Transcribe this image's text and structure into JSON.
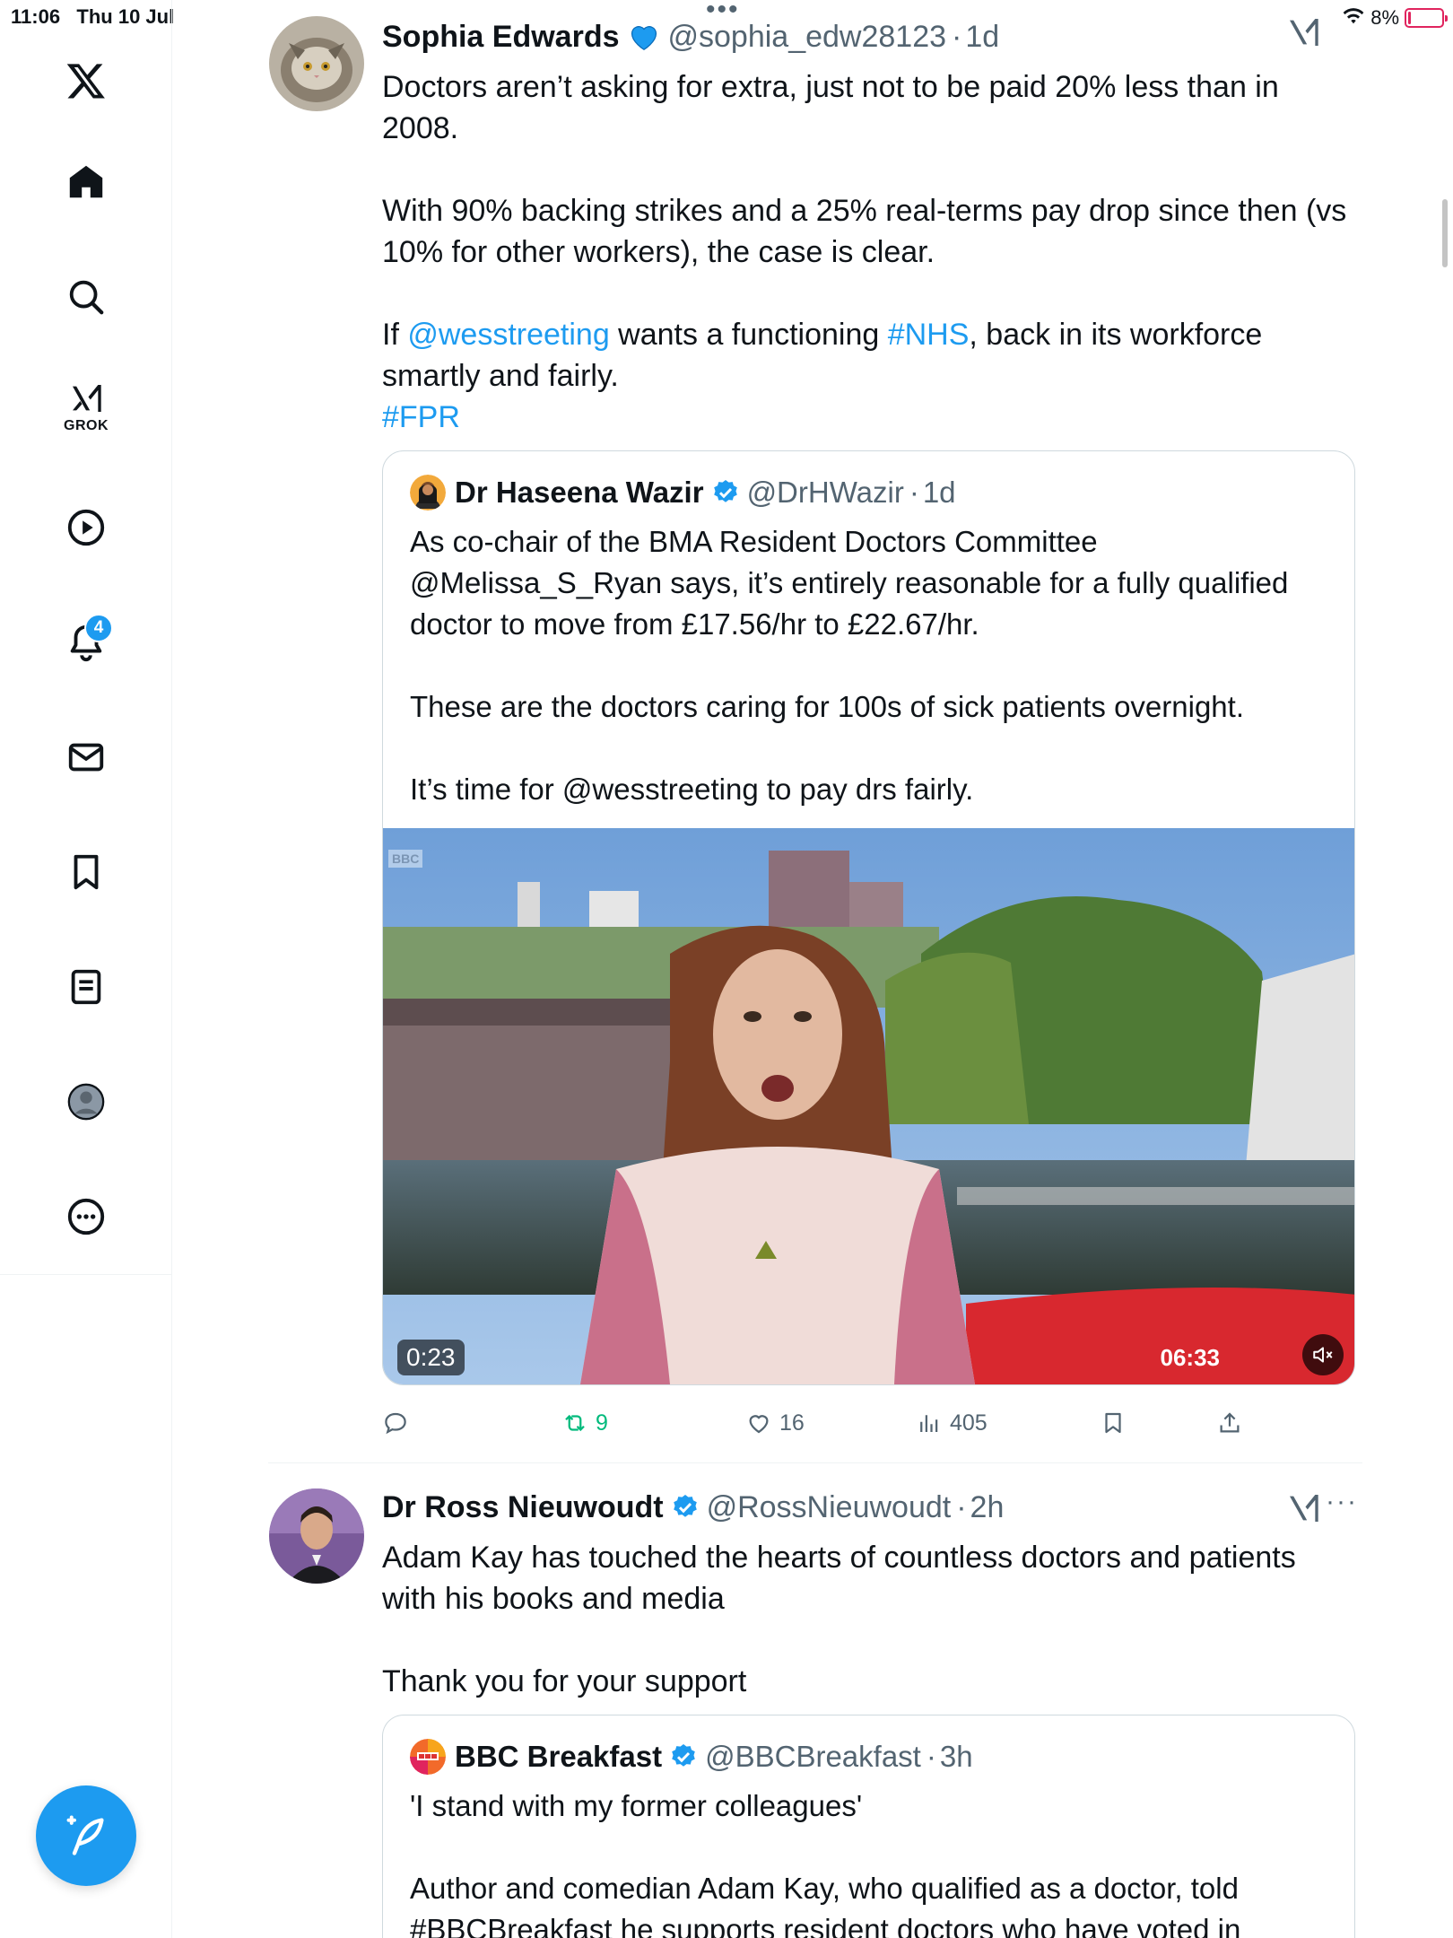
{
  "status_bar": {
    "time": "11:06",
    "date": "Thu 10 Jul",
    "battery": "8%",
    "battery_level": 0.08
  },
  "sidebar": {
    "grok_label": "GROK",
    "notifications_count": "4",
    "items": [
      "x-logo",
      "home-icon",
      "search-icon",
      "grok-icon",
      "video-icon",
      "notifications-icon",
      "messages-icon",
      "bookmarks-icon",
      "lists-icon",
      "profile-icon",
      "more-icon"
    ]
  },
  "posts": [
    {
      "display_name": "Sophia Edwards",
      "handle": "@sophia_edw28123",
      "age": "1d",
      "text": {
        "p1": "Doctors aren’t asking for extra, just not to be paid 20% less than in 2008.",
        "p2": "With 90% backing strikes and a 25% real-terms pay drop since then (vs 10% for other workers), the case is clear.",
        "p3_before": "If ",
        "p3_mention": "@wesstreeting",
        "p3_middle": " wants a functioning ",
        "p3_hashtag": "#NHS",
        "p3_after": ", back in its workforce smartly and fairly.",
        "hashtag": "#FPR"
      },
      "quote": {
        "display_name": "Dr Haseena Wazir",
        "handle": "@DrHWazir",
        "age": "1d",
        "p1": "As co-chair of the BMA Resident Doctors Committee @Melissa_S_Ryan says,  it’s entirely reasonable for a fully qualified doctor to move from £17.56/hr to £22.67/hr.",
        "p2": "These are the doctors caring for 100s of sick patients overnight.",
        "p3": "It’s time for @wesstreeting to pay drs fairly.",
        "video": {
          "duration": "0:23",
          "broadcast_clock": "06:33",
          "channel": "BBC"
        }
      },
      "actions": {
        "replies": "",
        "reposts": "9",
        "likes": "16",
        "views": "405"
      }
    },
    {
      "display_name": "Dr Ross Nieuwoudt",
      "handle": "@RossNieuwoudt",
      "age": "2h",
      "text": {
        "p1": "Adam Kay has touched the hearts of countless doctors and patients with his books and media",
        "p2": "Thank you for your support"
      },
      "quote": {
        "display_name": "BBC Breakfast",
        "handle": "@BBCBreakfast",
        "age": "3h",
        "p1": "'I stand with my former colleagues'",
        "p2": "Author and comedian Adam Kay, who qualified as a doctor, told #BBCBreakfast he supports resident doctors who have voted in"
      }
    }
  ],
  "colors": {
    "accent": "#1d9bf0",
    "repost_green": "#00ba7c",
    "muted_text": "#536471",
    "border": "#cfd9de"
  }
}
